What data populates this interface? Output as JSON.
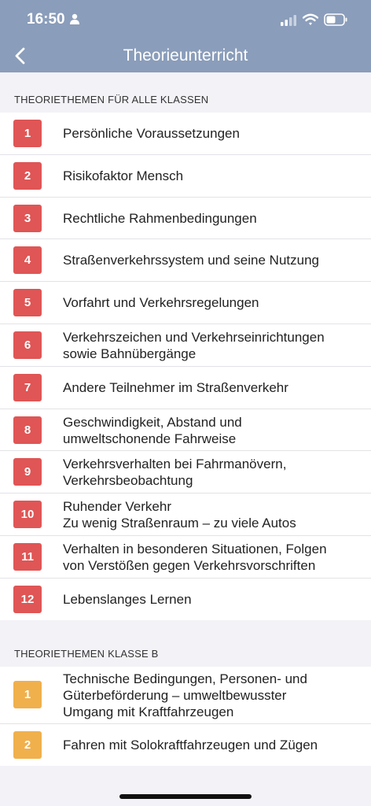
{
  "status": {
    "time": "16:50"
  },
  "nav": {
    "title": "Theorieunterricht"
  },
  "colors": {
    "header": "#8a9dba",
    "badge_red": "#e05555",
    "badge_orange": "#f0b04c"
  },
  "sections": [
    {
      "header": "THEORIETHEMEN FÜR ALLE KLASSEN",
      "items": [
        {
          "num": "1",
          "label": "Persönliche Voraussetzungen"
        },
        {
          "num": "2",
          "label": "Risikofaktor Mensch"
        },
        {
          "num": "3",
          "label": "Rechtliche Rahmenbedingungen"
        },
        {
          "num": "4",
          "label": "Straßenverkehrssystem und seine Nutzung"
        },
        {
          "num": "5",
          "label": "Vorfahrt und Verkehrsregelungen"
        },
        {
          "num": "6",
          "label": "Verkehrszeichen und Verkehrseinrichtungen\nsowie Bahnübergänge"
        },
        {
          "num": "7",
          "label": "Andere Teilnehmer im Straßenverkehr"
        },
        {
          "num": "8",
          "label": "Geschwindigkeit, Abstand und\numweltschonende Fahrweise"
        },
        {
          "num": "9",
          "label": "Verkehrsverhalten bei Fahrmanövern,\nVerkehrsbeobachtung"
        },
        {
          "num": "10",
          "label": "Ruhender Verkehr\nZu wenig Straßenraum – zu viele Autos"
        },
        {
          "num": "11",
          "label": "Verhalten in besonderen Situationen, Folgen\nvon Verstößen gegen Verkehrsvorschriften"
        },
        {
          "num": "12",
          "label": "Lebenslanges Lernen"
        }
      ]
    },
    {
      "header": "THEORIETHEMEN KLASSE B",
      "items": [
        {
          "num": "1",
          "label": "Technische Bedingungen, Personen- und\nGüterbeförderung – umweltbewusster\nUmgang mit Kraftfahrzeugen"
        },
        {
          "num": "2",
          "label": "Fahren mit Solokraftfahrzeugen und Zügen"
        }
      ]
    }
  ]
}
